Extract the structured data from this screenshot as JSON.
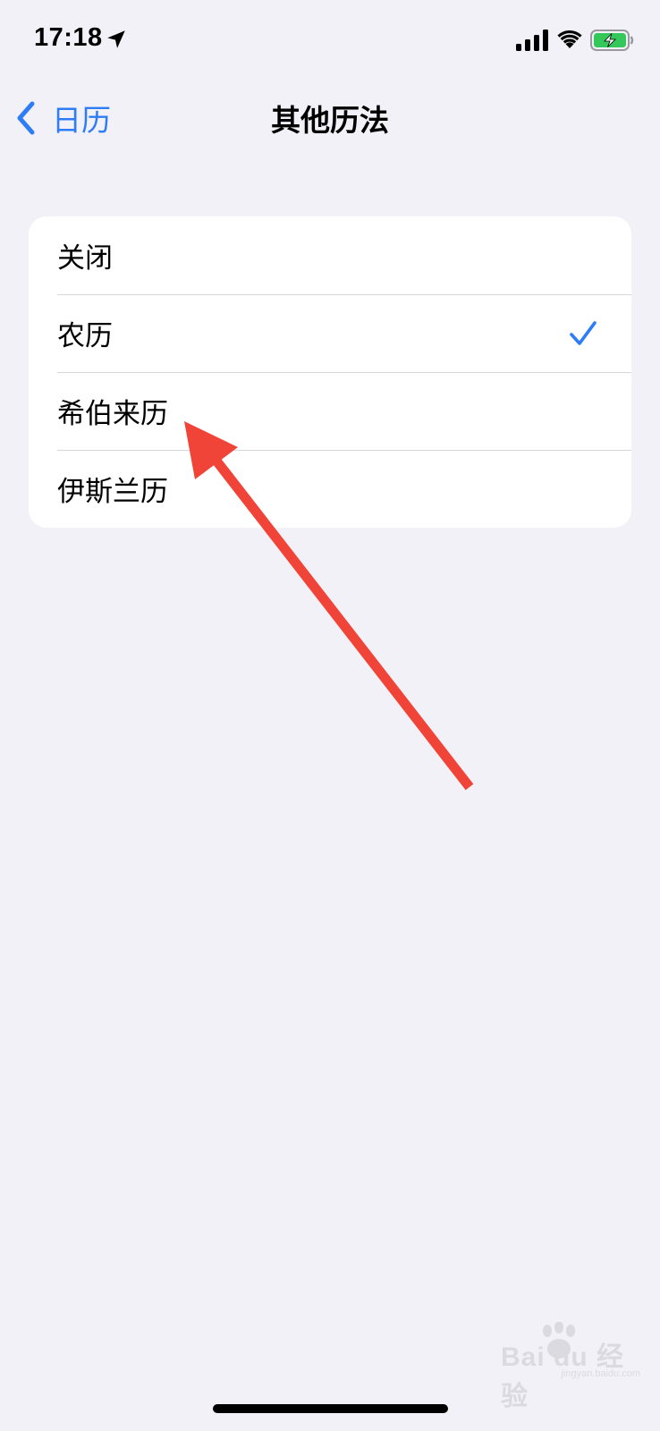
{
  "status_bar": {
    "time": "17:18",
    "location_icon": "location-arrow-icon",
    "signal_icon": "cellular-signal-icon",
    "wifi_icon": "wifi-icon",
    "battery_icon": "battery-charging-icon",
    "battery_color": "#34c759"
  },
  "nav": {
    "back_label": "日历",
    "title": "其他历法",
    "accent_color": "#2f7df6"
  },
  "options": [
    {
      "label": "关闭",
      "selected": false
    },
    {
      "label": "农历",
      "selected": true
    },
    {
      "label": "希伯来历",
      "selected": false
    },
    {
      "label": "伊斯兰历",
      "selected": false
    }
  ],
  "annotation": {
    "type": "red-arrow",
    "color": "#f04438",
    "points_to": "希伯来历"
  },
  "watermark": {
    "text": "Bai du 经验",
    "subtext": "jingyan.baidu.com"
  }
}
